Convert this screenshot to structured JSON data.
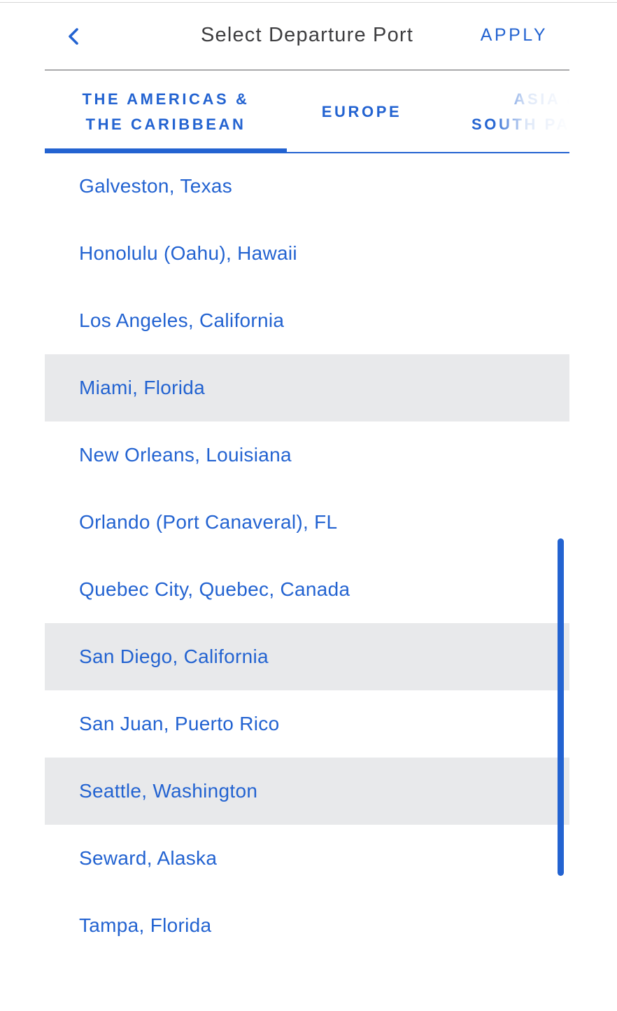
{
  "header": {
    "title": "Select Departure Port",
    "apply_label": "APPLY",
    "back_icon": "chevron-left-icon"
  },
  "tabs": [
    {
      "label": "THE AMERICAS &\nTHE CARIBBEAN",
      "active": true
    },
    {
      "label": "EUROPE",
      "active": false
    },
    {
      "label": "ASIA &\nSOUTH PACIFIC",
      "active": false
    }
  ],
  "ports": [
    {
      "label": "Galveston, Texas",
      "selected": false
    },
    {
      "label": "Honolulu (Oahu), Hawaii",
      "selected": false
    },
    {
      "label": "Los Angeles, California",
      "selected": false
    },
    {
      "label": "Miami, Florida",
      "selected": true
    },
    {
      "label": "New Orleans, Louisiana",
      "selected": false
    },
    {
      "label": "Orlando (Port Canaveral), FL",
      "selected": false
    },
    {
      "label": "Quebec City, Quebec, Canada",
      "selected": false
    },
    {
      "label": "San Diego, California",
      "selected": true
    },
    {
      "label": "San Juan, Puerto Rico",
      "selected": false
    },
    {
      "label": "Seattle, Washington",
      "selected": true
    },
    {
      "label": "Seward, Alaska",
      "selected": false
    },
    {
      "label": "Tampa, Florida",
      "selected": false
    }
  ],
  "colors": {
    "accent": "#2363d1",
    "selected_row": "#e8e9eb",
    "title_text": "#3d3d3f"
  }
}
